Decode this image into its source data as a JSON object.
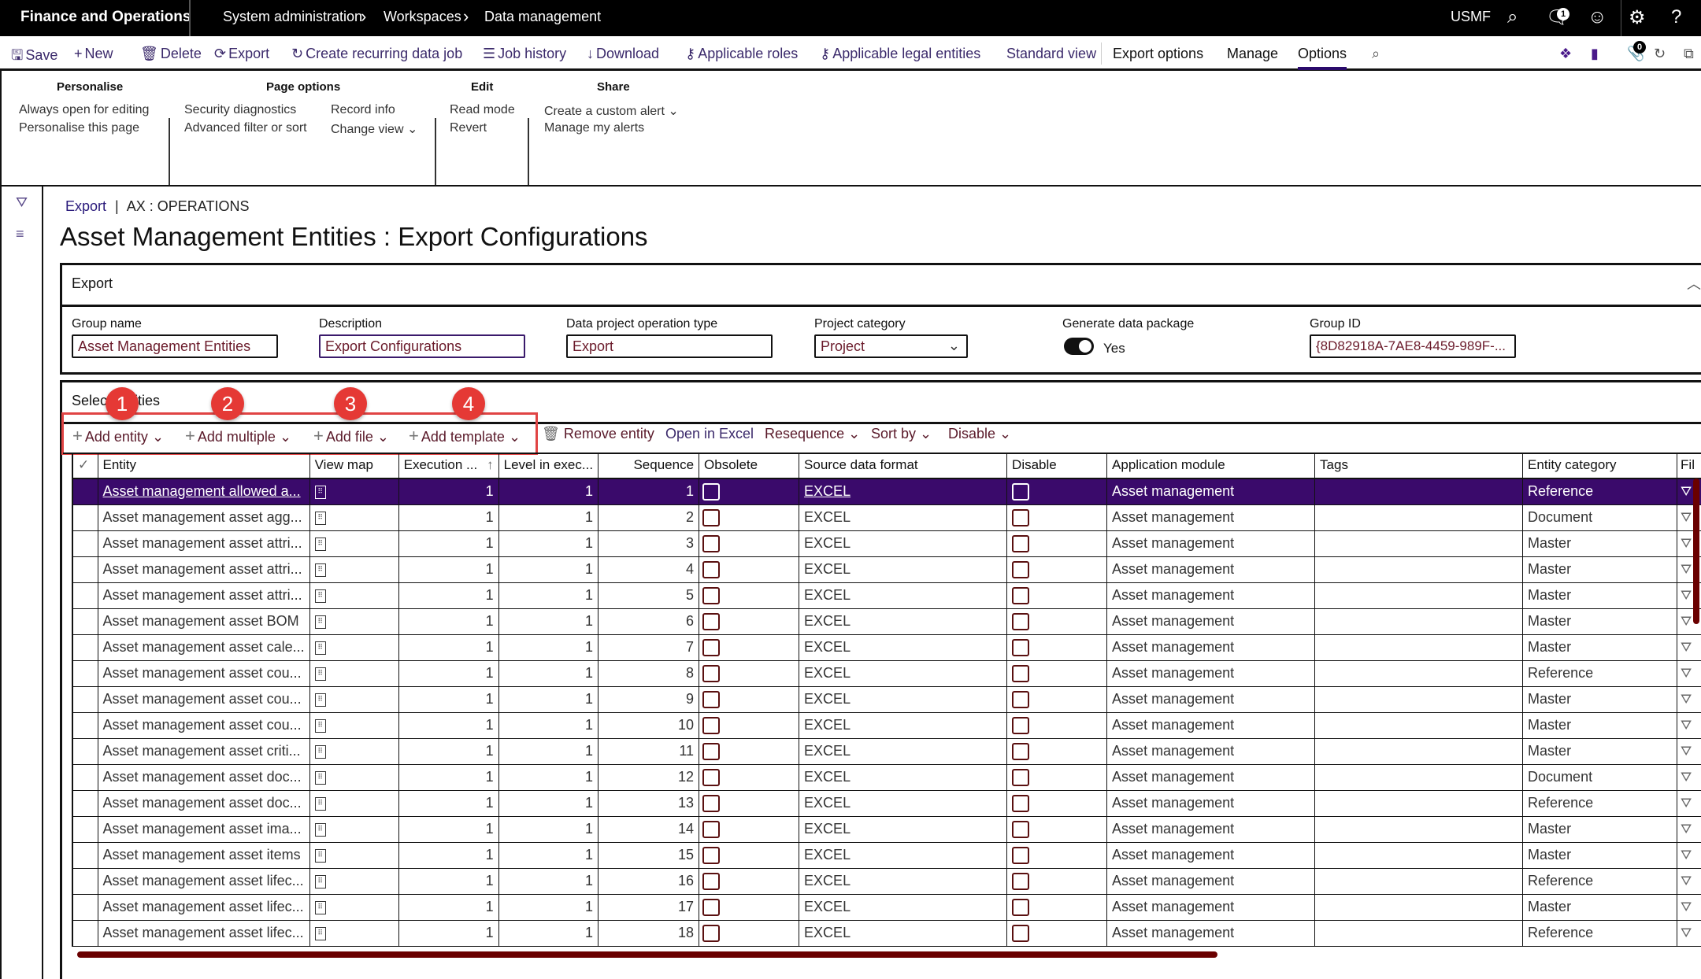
{
  "topbar": {
    "app_title": "Finance and Operations",
    "breadcrumbs": [
      "System administration",
      "Workspaces",
      "Data management"
    ],
    "company": "USMF",
    "notification_count": "1",
    "icons": [
      "search-icon",
      "notification-icon",
      "feedback-smiley-icon",
      "settings-gear-icon",
      "help-icon"
    ]
  },
  "actionbar": {
    "items": [
      {
        "label": "Save",
        "icon": "save-icon"
      },
      {
        "label": "New",
        "icon": "plus-icon"
      },
      {
        "label": "Delete",
        "icon": "delete-icon"
      },
      {
        "label": "Export",
        "icon": "export-icon"
      },
      {
        "label": "Create recurring data job",
        "icon": "recurring-icon"
      },
      {
        "label": "Job history",
        "icon": "list-icon"
      },
      {
        "label": "Download",
        "icon": "download-icon"
      },
      {
        "label": "Applicable roles",
        "icon": "key-icon"
      },
      {
        "label": "Applicable legal entities",
        "icon": "key-icon"
      },
      {
        "label": "Standard view",
        "icon": ""
      }
    ],
    "tabs": [
      "Export options",
      "Manage",
      "Options"
    ],
    "selected_tab": "Options",
    "attachments_count": "0"
  },
  "options": {
    "groups": [
      {
        "header": "Personalise",
        "items": [
          "Always open for editing",
          "Personalise this page"
        ]
      },
      {
        "header": "Page options",
        "items": [
          "Security diagnostics",
          "Advanced filter or sort",
          "Record info",
          "Change view"
        ]
      },
      {
        "header": "Edit",
        "items": [
          "Read mode",
          "Revert"
        ]
      },
      {
        "header": "Share",
        "items": [
          "Create a custom alert",
          "Manage my alerts"
        ]
      }
    ]
  },
  "breadcrumb": {
    "link": "Export",
    "separator": "|",
    "context": "AX : OPERATIONS"
  },
  "page_title": "Asset Management Entities : Export Configurations",
  "export_section": {
    "header": "Export",
    "fields": {
      "group_name": {
        "label": "Group name",
        "value": "Asset Management Entities"
      },
      "description": {
        "label": "Description",
        "value": "Export Configurations"
      },
      "operation_type": {
        "label": "Data project operation type",
        "value": "Export"
      },
      "project_category": {
        "label": "Project category",
        "value": "Project"
      },
      "generate_package": {
        "label": "Generate data package",
        "value": "Yes"
      },
      "group_id": {
        "label": "Group ID",
        "value": "{8D82918A-7AE8-4459-989F-..."
      }
    }
  },
  "entities_section": {
    "header": "Select entities",
    "annotations": [
      "1",
      "2",
      "3",
      "4"
    ],
    "toolbar": {
      "add_entity": "Add entity",
      "add_multiple": "Add multiple",
      "add_file": "Add file",
      "add_template": "Add template",
      "remove_entity": "Remove entity",
      "open_in_excel": "Open in Excel",
      "resequence": "Resequence",
      "sort_by": "Sort by",
      "disable": "Disable"
    },
    "columns": [
      "Entity",
      "View map",
      "Execution ...",
      "Level in exec...",
      "Sequence",
      "Obsolete",
      "Source data format",
      "Disable",
      "Application module",
      "Tags",
      "Entity category",
      "Fil"
    ],
    "rows": [
      {
        "entity": "Asset management allowed a...",
        "exec": "1",
        "level": "1",
        "seq": "1",
        "format": "EXCEL",
        "module": "Asset management",
        "tags": "",
        "category": "Reference",
        "selected": true
      },
      {
        "entity": "Asset management asset agg...",
        "exec": "1",
        "level": "1",
        "seq": "2",
        "format": "EXCEL",
        "module": "Asset management",
        "tags": "",
        "category": "Document"
      },
      {
        "entity": "Asset management asset attri...",
        "exec": "1",
        "level": "1",
        "seq": "3",
        "format": "EXCEL",
        "module": "Asset management",
        "tags": "",
        "category": "Master"
      },
      {
        "entity": "Asset management asset attri...",
        "exec": "1",
        "level": "1",
        "seq": "4",
        "format": "EXCEL",
        "module": "Asset management",
        "tags": "",
        "category": "Master"
      },
      {
        "entity": "Asset management asset attri...",
        "exec": "1",
        "level": "1",
        "seq": "5",
        "format": "EXCEL",
        "module": "Asset management",
        "tags": "",
        "category": "Master"
      },
      {
        "entity": "Asset management asset BOM",
        "exec": "1",
        "level": "1",
        "seq": "6",
        "format": "EXCEL",
        "module": "Asset management",
        "tags": "",
        "category": "Master"
      },
      {
        "entity": "Asset management asset cale...",
        "exec": "1",
        "level": "1",
        "seq": "7",
        "format": "EXCEL",
        "module": "Asset management",
        "tags": "",
        "category": "Master"
      },
      {
        "entity": "Asset management asset cou...",
        "exec": "1",
        "level": "1",
        "seq": "8",
        "format": "EXCEL",
        "module": "Asset management",
        "tags": "",
        "category": "Reference"
      },
      {
        "entity": "Asset management asset cou...",
        "exec": "1",
        "level": "1",
        "seq": "9",
        "format": "EXCEL",
        "module": "Asset management",
        "tags": "",
        "category": "Master"
      },
      {
        "entity": "Asset management asset cou...",
        "exec": "1",
        "level": "1",
        "seq": "10",
        "format": "EXCEL",
        "module": "Asset management",
        "tags": "",
        "category": "Master"
      },
      {
        "entity": "Asset management asset criti...",
        "exec": "1",
        "level": "1",
        "seq": "11",
        "format": "EXCEL",
        "module": "Asset management",
        "tags": "",
        "category": "Master"
      },
      {
        "entity": "Asset management asset doc...",
        "exec": "1",
        "level": "1",
        "seq": "12",
        "format": "EXCEL",
        "module": "Asset management",
        "tags": "",
        "category": "Document"
      },
      {
        "entity": "Asset management asset doc...",
        "exec": "1",
        "level": "1",
        "seq": "13",
        "format": "EXCEL",
        "module": "Asset management",
        "tags": "",
        "category": "Reference"
      },
      {
        "entity": "Asset management asset ima...",
        "exec": "1",
        "level": "1",
        "seq": "14",
        "format": "EXCEL",
        "module": "Asset management",
        "tags": "",
        "category": "Master"
      },
      {
        "entity": "Asset management asset items",
        "exec": "1",
        "level": "1",
        "seq": "15",
        "format": "EXCEL",
        "module": "Asset management",
        "tags": "",
        "category": "Master"
      },
      {
        "entity": "Asset management asset lifec...",
        "exec": "1",
        "level": "1",
        "seq": "16",
        "format": "EXCEL",
        "module": "Asset management",
        "tags": "",
        "category": "Reference"
      },
      {
        "entity": "Asset management asset lifec...",
        "exec": "1",
        "level": "1",
        "seq": "17",
        "format": "EXCEL",
        "module": "Asset management",
        "tags": "",
        "category": "Master"
      },
      {
        "entity": "Asset management asset lifec...",
        "exec": "1",
        "level": "1",
        "seq": "18",
        "format": "EXCEL",
        "module": "Asset management",
        "tags": "",
        "category": "Reference"
      }
    ]
  }
}
